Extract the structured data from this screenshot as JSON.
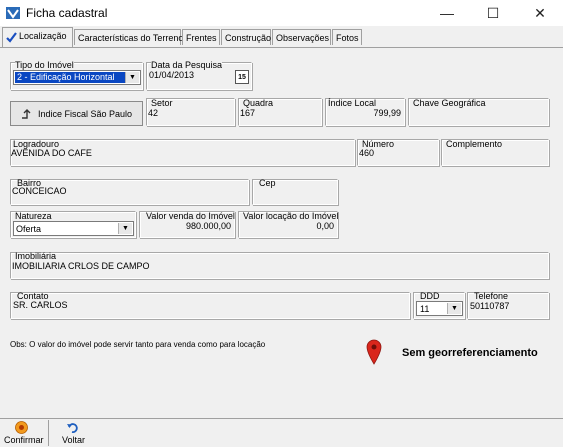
{
  "window": {
    "title": "Ficha cadastral",
    "minimize_glyph": "—",
    "maximize_glyph": "☐",
    "close_glyph": "✕"
  },
  "tabs": [
    {
      "label": "Localização"
    },
    {
      "label": "Características do Terreno"
    },
    {
      "label": "Frentes"
    },
    {
      "label": "Construção"
    },
    {
      "label": "Observações"
    },
    {
      "label": "Fotos"
    }
  ],
  "form": {
    "tipo_imovel": {
      "label": "Tipo do Imóvel",
      "value": "2 - Edificação Horizontal"
    },
    "data_pesquisa": {
      "label": "Data da Pesquisa",
      "value": "01/04/2013",
      "calendar_glyph": "15"
    },
    "indice_fiscal_button": "Indice Fiscal São Paulo",
    "setor": {
      "label": "Setor",
      "value": "42"
    },
    "quadra": {
      "label": "Quadra",
      "value": "167"
    },
    "indice_local": {
      "label": "Índice Local",
      "value": "799,99"
    },
    "chave_geografica": {
      "label": "Chave Geográfica",
      "value": ""
    },
    "logradouro": {
      "label": "Logradouro",
      "value": "AVENIDA DO CAFE"
    },
    "numero": {
      "label": "Número",
      "value": "460"
    },
    "complemento": {
      "label": "Complemento",
      "value": ""
    },
    "bairro": {
      "label": "Bairro",
      "value": "CONCEICAO"
    },
    "cep": {
      "label": "Cep",
      "value": ""
    },
    "natureza": {
      "label": "Natureza",
      "value": "Oferta"
    },
    "valor_venda": {
      "label": "Valor venda do Imóvel",
      "value": "980.000,00"
    },
    "valor_locacao": {
      "label": "Valor locação do Imóvel",
      "value": "0,00"
    },
    "imobiliaria": {
      "label": "Imobiliária",
      "value": "IMOBILIARIA CRLOS DE CAMPO"
    },
    "contato": {
      "label": "Contato",
      "value": "SR. CARLOS"
    },
    "ddd": {
      "label": "DDD",
      "value": "11"
    },
    "telefone": {
      "label": "Telefone",
      "value": "50110787"
    }
  },
  "obs_text": "Obs: O valor do imóvel pode servir tanto para venda como para locação",
  "geo_status": "Sem georreferenciamento",
  "bottom": {
    "confirm_label": "Confirmar",
    "back_label": "Voltar"
  },
  "colors": {
    "selected_combo": "#0a47c2",
    "pin": "#d9261c",
    "check": "#1a4fc0"
  },
  "icons": {
    "app": "app-icon",
    "tab_check": "check-icon",
    "pin": "map-pin-icon",
    "confirm": "confirm-icon",
    "back": "undo-icon"
  }
}
